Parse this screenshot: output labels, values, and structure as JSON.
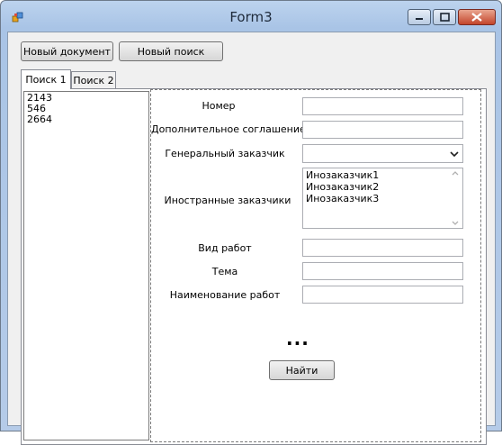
{
  "window": {
    "title": "Form3"
  },
  "toolbar": {
    "new_document": "Новый документ",
    "new_search": "Новый поиск"
  },
  "tabs": [
    {
      "label": "Поиск 1",
      "active": true
    },
    {
      "label": "Поиск 2",
      "active": false
    }
  ],
  "results": [
    "2143",
    "546",
    "2664"
  ],
  "form": {
    "labels": {
      "number": "Номер",
      "supplementary_agreement": "Дополнительное соглашение",
      "general_customer": "Генеральный заказчик",
      "foreign_customers": "Иностранные заказчики",
      "work_type": "Вид работ",
      "topic": "Тема",
      "work_name": "Наименование работ"
    },
    "values": {
      "number": "",
      "supplementary_agreement": "",
      "general_customer": "",
      "work_type": "",
      "topic": "",
      "work_name": ""
    },
    "foreign_customers_options": [
      "Инозаказчик1",
      "Инозаказчик2",
      "Инозаказчик3"
    ],
    "ellipsis": "...",
    "find_button": "Найти"
  },
  "colors": {
    "title_text": "#1e2a3a",
    "close_button": "#c3452b"
  },
  "icons": [
    "app-icon",
    "minimize-icon",
    "maximize-icon",
    "close-icon",
    "chevron-down-icon",
    "scroll-up-icon",
    "scroll-down-icon"
  ]
}
